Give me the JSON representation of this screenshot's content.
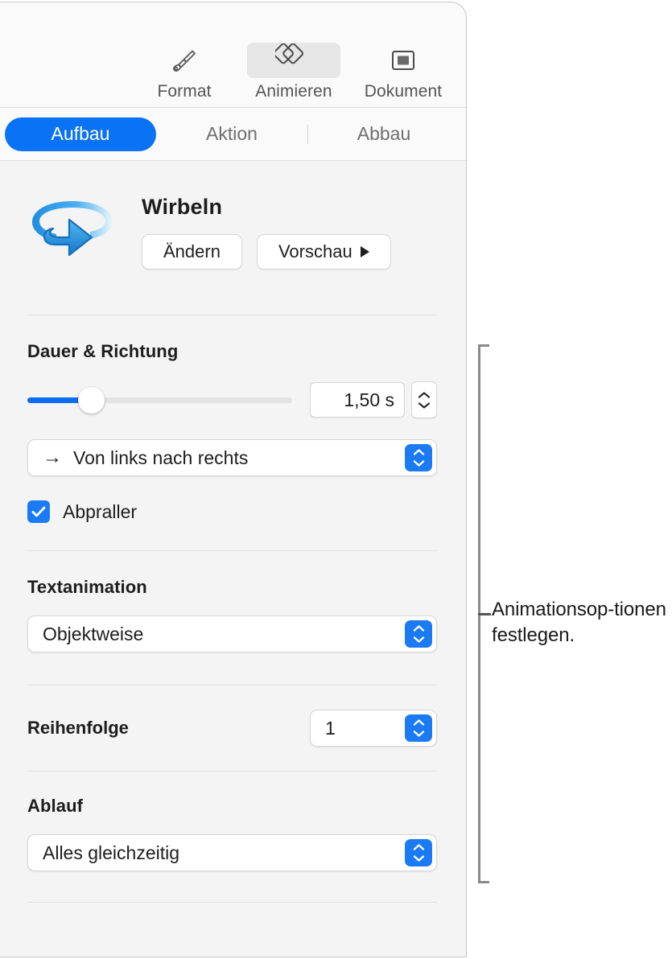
{
  "toolbar": {
    "items": [
      {
        "label": "Format",
        "icon": "paintbrush-icon",
        "selected": false
      },
      {
        "label": "Animieren",
        "icon": "animate-diamonds-icon",
        "selected": true
      },
      {
        "label": "Dokument",
        "icon": "document-icon",
        "selected": false
      }
    ]
  },
  "segmented": {
    "tabs": [
      {
        "label": "Aufbau",
        "active": true
      },
      {
        "label": "Aktion",
        "active": false
      },
      {
        "label": "Abbau",
        "active": false
      }
    ]
  },
  "animation": {
    "icon": "swirl-arrow-icon",
    "name": "Wirbeln",
    "change_button": "Ändern",
    "preview_button": "Vorschau"
  },
  "duration": {
    "section_title": "Dauer & Richtung",
    "slider_percent": 24,
    "value": "1,50 s",
    "direction_value": "Von links nach rechts",
    "direction_arrow": "→",
    "bounce_label": "Abpraller",
    "bounce_checked": true
  },
  "text_animation": {
    "section_title": "Textanimation",
    "value": "Objektweise"
  },
  "order": {
    "label": "Reihenfolge",
    "value": "1"
  },
  "delivery": {
    "label": "Ablauf",
    "value": "Alles gleichzeitig"
  },
  "callout": {
    "text": "Animationsop-tionen festlegen."
  },
  "colors": {
    "accent": "#0a72f5",
    "popup_chevron": "#1a7bf5",
    "panel_bg": "#f4f4f4",
    "toolbar_bg": "#fafafa"
  }
}
